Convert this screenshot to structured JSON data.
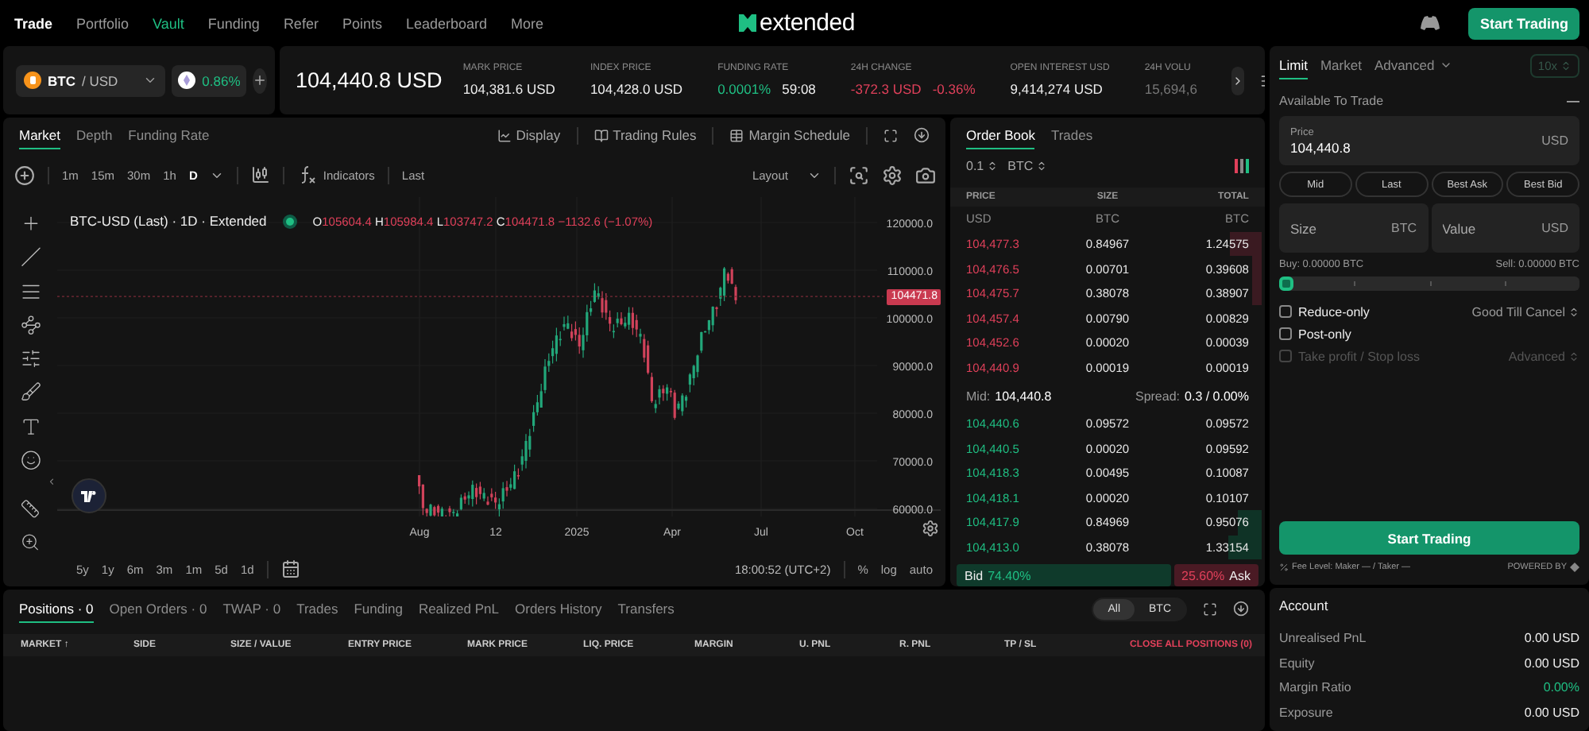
{
  "nav": {
    "links": [
      {
        "label": "Trade",
        "selected": true,
        "kind": "plain"
      },
      {
        "label": "Portfolio",
        "selected": false,
        "kind": "plain"
      },
      {
        "label": "Vault",
        "selected": false,
        "kind": "promo"
      },
      {
        "label": "Funding",
        "selected": false,
        "kind": "plain"
      },
      {
        "label": "Refer",
        "selected": false,
        "kind": "plain"
      },
      {
        "label": "Points",
        "selected": false,
        "kind": "plain"
      },
      {
        "label": "Leaderboard",
        "selected": false,
        "kind": "plain"
      },
      {
        "label": "More",
        "selected": false,
        "kind": "plain"
      }
    ],
    "logo": "extended",
    "cta": "Start Trading"
  },
  "ticker": {
    "base": "BTC",
    "quote": "/ USD",
    "change": "0.86%",
    "price": "104,440.8 USD",
    "stats": [
      {
        "label": "MARK PRICE",
        "values": [
          {
            "text": "104,381.6 USD",
            "kind": "neutral"
          }
        ]
      },
      {
        "label": "INDEX PRICE",
        "values": [
          {
            "text": "104,428.0 USD",
            "kind": "neutral"
          }
        ]
      },
      {
        "label": "FUNDING RATE",
        "values": [
          {
            "text": "0.0001%",
            "kind": "up"
          },
          {
            "text": "59:08",
            "kind": "neutral"
          }
        ]
      },
      {
        "label": "24H CHANGE",
        "values": [
          {
            "text": "-372.3 USD",
            "kind": "down"
          },
          {
            "text": "-0.36%",
            "kind": "down"
          }
        ]
      },
      {
        "label": "OPEN INTEREST USD",
        "values": [
          {
            "text": "9,414,274 USD",
            "kind": "neutral"
          }
        ]
      },
      {
        "label": "24H VOLU",
        "values": [
          {
            "text": "15,694,6",
            "kind": "faded"
          }
        ]
      }
    ]
  },
  "chart": {
    "tabs": [
      {
        "label": "Market",
        "selected": true
      },
      {
        "label": "Depth",
        "selected": false
      },
      {
        "label": "Funding Rate",
        "selected": false
      }
    ],
    "actions": [
      "Display",
      "Trading Rules",
      "Margin Schedule"
    ],
    "intervals": [
      {
        "label": "1m",
        "selected": false
      },
      {
        "label": "15m",
        "selected": false
      },
      {
        "label": "30m",
        "selected": false
      },
      {
        "label": "1h",
        "selected": false
      },
      {
        "label": "D",
        "selected": true
      }
    ],
    "indicators": "Indicators",
    "price_source": "Last",
    "layout": "Layout",
    "legend": "BTC-USD (Last) · 1D · Extended",
    "ohlc": [
      {
        "key": "O",
        "value": "105604.4"
      },
      {
        "key": "H",
        "value": "105984.4"
      },
      {
        "key": "L",
        "value": "103747.2"
      },
      {
        "key": "C",
        "value": "104471.8"
      }
    ],
    "change": "−1132.6 (−1.07%)",
    "y_ticks": [
      "120000.0",
      "110000.0",
      "100000.0",
      "90000.0",
      "80000.0",
      "70000.0",
      "60000.0"
    ],
    "last_price": "104471.8",
    "x_ticks": [
      "Aug",
      "12",
      "2025",
      "Apr",
      "Jul",
      "Oct"
    ],
    "ranges": [
      "5y",
      "1y",
      "6m",
      "3m",
      "1m",
      "5d",
      "1d"
    ],
    "time": "18:00:52 (UTC+2)",
    "percent": "%",
    "log": "log",
    "auto": "auto"
  },
  "order_book": {
    "tabs": [
      {
        "label": "Order Book",
        "selected": true
      },
      {
        "label": "Trades",
        "selected": false
      }
    ],
    "step": "0.1",
    "unit": "BTC",
    "columns": [
      {
        "name": "PRICE",
        "unit": "USD"
      },
      {
        "name": "SIZE",
        "unit": "BTC"
      },
      {
        "name": "TOTAL",
        "unit": "BTC"
      }
    ],
    "asks": [
      {
        "price": "104,477.3",
        "size": "0.84967",
        "total": "1.24575"
      },
      {
        "price": "104,476.5",
        "size": "0.00701",
        "total": "0.39608"
      },
      {
        "price": "104,475.7",
        "size": "0.38078",
        "total": "0.38907"
      },
      {
        "price": "104,457.4",
        "size": "0.00790",
        "total": "0.00829"
      },
      {
        "price": "104,452.6",
        "size": "0.00020",
        "total": "0.00039"
      },
      {
        "price": "104,440.9",
        "size": "0.00019",
        "total": "0.00019"
      }
    ],
    "mid_label": "Mid:",
    "mid": "104,440.8",
    "spread_label": "Spread:",
    "spread": "0.3 / 0.00%",
    "bids": [
      {
        "price": "104,440.6",
        "size": "0.09572",
        "total": "0.09572"
      },
      {
        "price": "104,440.5",
        "size": "0.00020",
        "total": "0.09592"
      },
      {
        "price": "104,418.3",
        "size": "0.00495",
        "total": "0.10087"
      },
      {
        "price": "104,418.1",
        "size": "0.00020",
        "total": "0.10107"
      },
      {
        "price": "104,417.9",
        "size": "0.84969",
        "total": "0.95076"
      },
      {
        "price": "104,413.0",
        "size": "0.38078",
        "total": "1.33154"
      }
    ],
    "ratio": {
      "bid_label": "Bid",
      "bid": "74.40%",
      "ask": "25.60%",
      "ask_label": "Ask"
    }
  },
  "order_form": {
    "tabs": [
      {
        "label": "Limit",
        "selected": true
      },
      {
        "label": "Market",
        "selected": false
      },
      {
        "label": "Advanced",
        "selected": false
      }
    ],
    "leverage": "10x",
    "available": "Available To Trade",
    "available_value": "—",
    "price": {
      "label": "Price",
      "value": "104,440.8",
      "unit": "USD"
    },
    "quick": [
      "Mid",
      "Last",
      "Best Ask",
      "Best Bid"
    ],
    "size": {
      "placeholder": "Size",
      "unit": "BTC"
    },
    "value": {
      "placeholder": "Value",
      "unit": "USD"
    },
    "buy": "Buy: 0.00000 BTC",
    "sell": "Sell: 0.00000 BTC",
    "slider": {
      "level": 0
    },
    "options": [
      {
        "label": "Reduce-only",
        "checked": false,
        "disabled": false,
        "select": "Good Till Cancel"
      },
      {
        "label": "Post-only",
        "checked": false,
        "disabled": false
      },
      {
        "label": "Take profit / Stop loss",
        "checked": false,
        "disabled": true,
        "select": "Advanced"
      }
    ],
    "submit": "Start Trading",
    "fee": "Fee Level: Maker — / Taker —",
    "powered": "POWERED BY"
  },
  "account": {
    "title": "Account",
    "rows": [
      {
        "label": "Unrealised PnL",
        "value": "0.00 USD",
        "kind": "neutral"
      },
      {
        "label": "Equity",
        "value": "0.00 USD",
        "kind": "neutral"
      },
      {
        "label": "Margin Ratio",
        "value": "0.00%",
        "kind": "up"
      },
      {
        "label": "Exposure",
        "value": "0.00 USD",
        "kind": "neutral"
      }
    ]
  },
  "positions": {
    "tabs": [
      {
        "label": "Positions · 0",
        "selected": true
      },
      {
        "label": "Open Orders · 0",
        "selected": false
      },
      {
        "label": "TWAP · 0",
        "selected": false
      },
      {
        "label": "Trades",
        "selected": false
      },
      {
        "label": "Funding",
        "selected": false
      },
      {
        "label": "Realized PnL",
        "selected": false
      },
      {
        "label": "Orders History",
        "selected": false
      },
      {
        "label": "Transfers",
        "selected": false
      }
    ],
    "filters": [
      {
        "label": "All",
        "selected": true
      },
      {
        "label": "BTC",
        "selected": false
      }
    ],
    "columns": [
      "MARKET ↑",
      "SIDE",
      "SIZE / VALUE",
      "ENTRY PRICE",
      "MARK PRICE",
      "LIQ. PRICE",
      "MARGIN",
      "U. PNL",
      "R. PNL",
      "TP / SL"
    ],
    "close_all": "CLOSE ALL POSITIONS (0)"
  }
}
